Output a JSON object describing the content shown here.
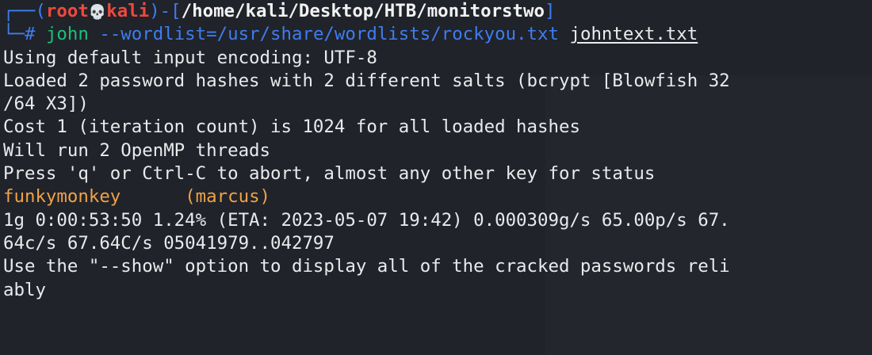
{
  "prompt": {
    "corner_top": "┌──(",
    "user": "root",
    "skull_icon": "💀",
    "host": "kali",
    "mid": ")-[",
    "path": "/home/kali/Desktop/HTB/monitorstwo",
    "close": "]",
    "corner_bottom": "└─",
    "hash": "#",
    "command": "john",
    "argument": "--wordlist=/usr/share/wordlists/rockyou.txt",
    "target_file": "johntext.txt"
  },
  "output": {
    "line1": "Using default input encoding: UTF-8",
    "line2": "Loaded 2 password hashes with 2 different salts (bcrypt [Blowfish 32",
    "line3": "/64 X3])",
    "line4": "Cost 1 (iteration count) is 1024 for all loaded hashes",
    "line5": "Will run 2 OpenMP threads",
    "line6": "Press 'q' or Ctrl-C to abort, almost any other key for status",
    "cracked_password": "funkymonkey",
    "cracked_user": "(marcus)",
    "line8": "1g 0:00:53:50 1.24% (ETA: 2023-05-07 19:42) 0.000309g/s 65.00p/s 67.",
    "line9": "64c/s 67.64C/s 05041979..042797",
    "line10": "Use the \"--show\" option to display all of the cracked passwords reli",
    "line11": "ably"
  },
  "colors": {
    "background": "#20232a",
    "prompt_frame": "#3e7df0",
    "prompt_user_host": "#f0483e",
    "command": "#1bc07a",
    "cracked": "#f0a246"
  }
}
